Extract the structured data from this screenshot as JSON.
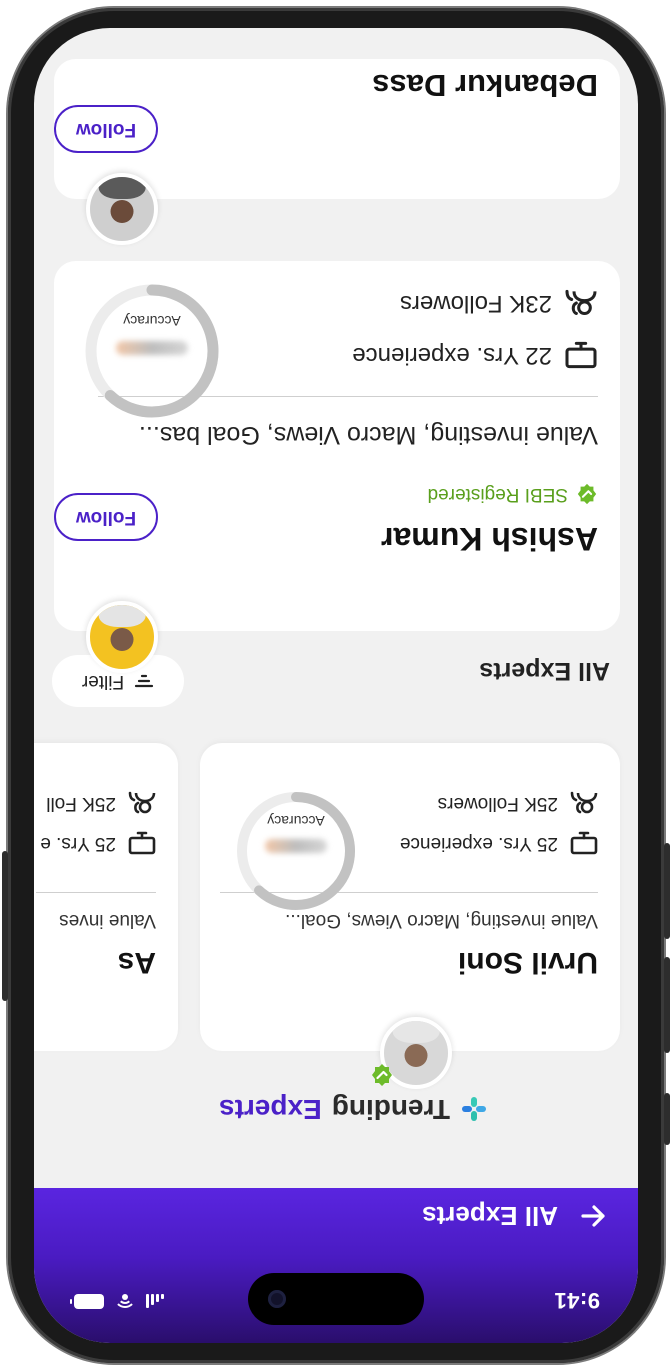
{
  "status_bar": {
    "time": "9:41"
  },
  "header": {
    "title": "All Experts"
  },
  "trending": {
    "title_part1": "Trending",
    "title_part2": "Experts",
    "cards": [
      {
        "name": "Urvil Soni",
        "tags": "Value investing, Macro Views, Goal...",
        "experience": "25 Yrs. experience",
        "followers": "25K Followers",
        "gauge_label": "Accuracy",
        "accuracy": 0.62
      },
      {
        "name": "As",
        "tags": "Value inves",
        "experience": "25 Yrs. e",
        "followers": "25K Foll"
      }
    ]
  },
  "all_experts": {
    "title": "All Experts",
    "filter_label": "Filter",
    "experts": [
      {
        "name": "Ashish Kumar",
        "badge": "SEBI Registered",
        "tags": "Value investing, Macro Views, Goal bas...",
        "experience": "22 Yrs. experience",
        "followers": "23K Followers",
        "gauge_label": "Accuracy",
        "accuracy": 0.62,
        "follow_label": "Follow"
      },
      {
        "name": "Debankur Dass",
        "follow_label": "Follow"
      }
    ]
  },
  "colors": {
    "brand": "#4b21c8",
    "verified": "#5a9f1c",
    "background": "#f1f1f1"
  }
}
